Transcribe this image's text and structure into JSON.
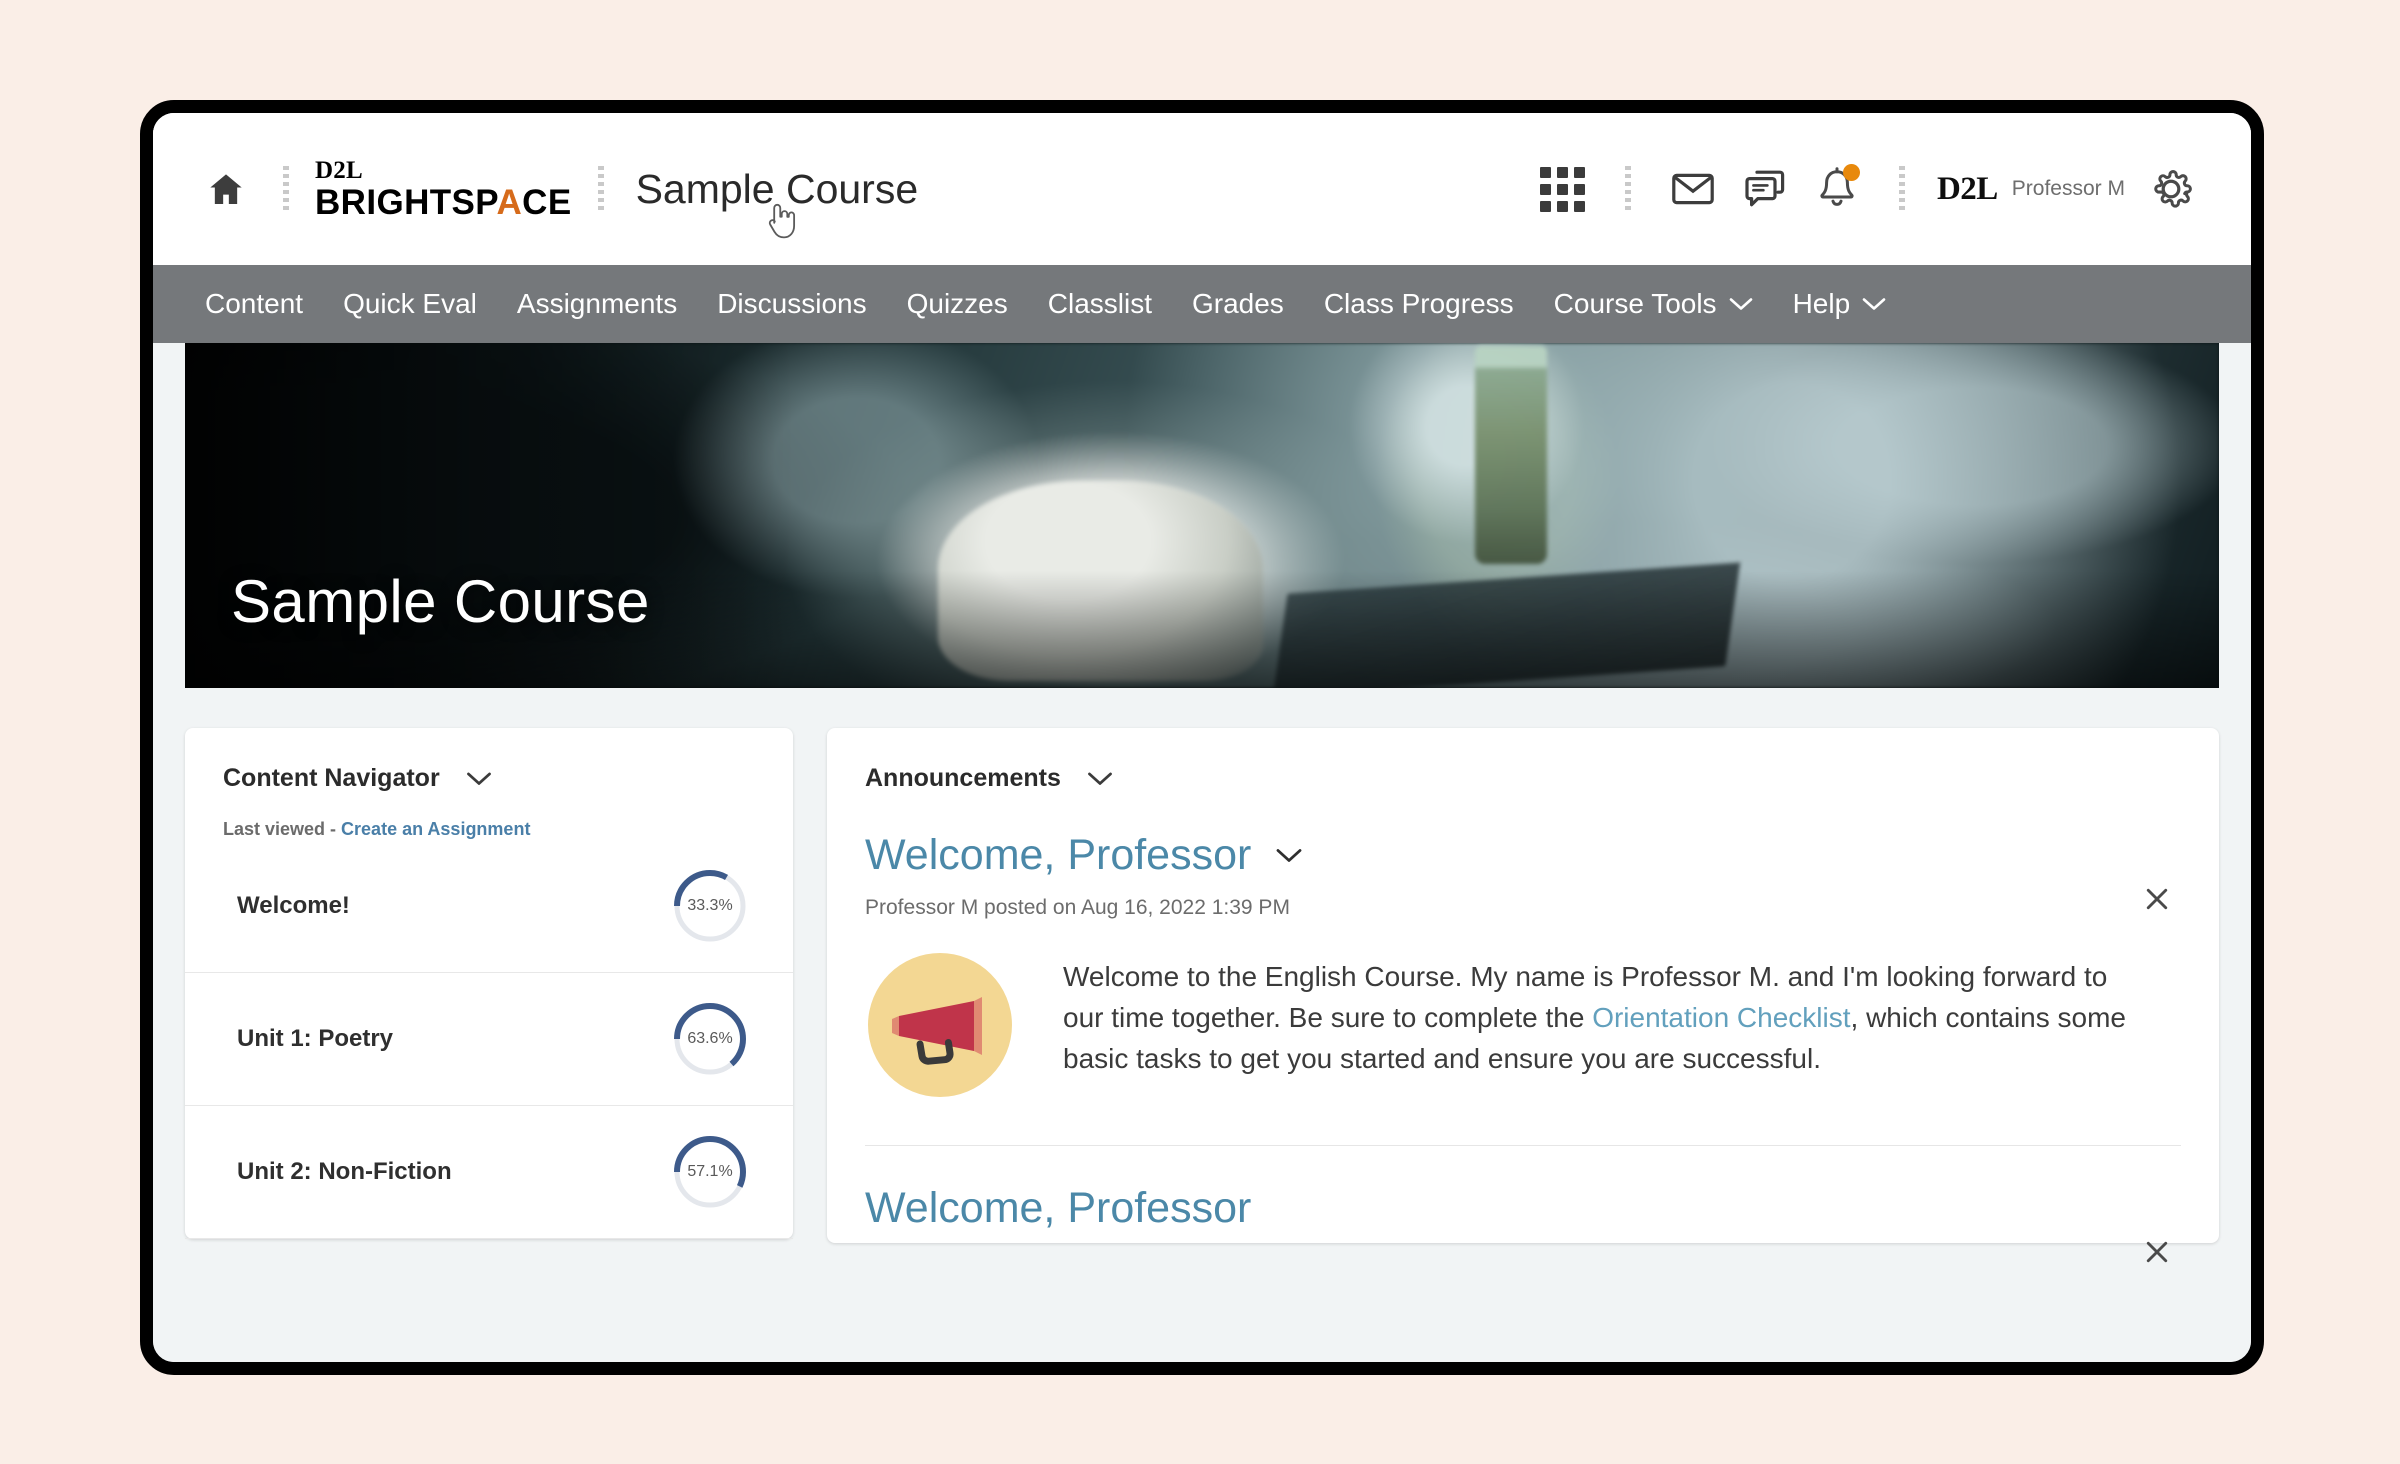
{
  "page": {
    "background_color": "#faeee7",
    "frame_border_color": "#000000"
  },
  "header": {
    "home_icon": "home-icon",
    "brand_line1": "D2L",
    "brand_line2_a": "BRIGHTSP",
    "brand_line2_accent": "A",
    "brand_line2_b": "CE",
    "course_title": "Sample Course",
    "cursor": "pointer-hand-cursor",
    "icons": [
      {
        "name": "waffle-menu-icon",
        "label": "Course Selector"
      },
      {
        "name": "envelope-icon",
        "label": "Email"
      },
      {
        "name": "chat-bubble-icon",
        "label": "Subscriptions"
      },
      {
        "name": "bell-icon",
        "label": "Notifications",
        "badge": true
      }
    ],
    "user": {
      "mark": "D2L",
      "name": "Professor M"
    },
    "settings_icon": "gear-icon",
    "accent_color": "#d66b1b",
    "badge_color": "#e8890c"
  },
  "navbar": {
    "background_color": "#75787b",
    "items": [
      {
        "label": "Content",
        "has_chevron": false
      },
      {
        "label": "Quick Eval",
        "has_chevron": false
      },
      {
        "label": "Assignments",
        "has_chevron": false
      },
      {
        "label": "Discussions",
        "has_chevron": false
      },
      {
        "label": "Quizzes",
        "has_chevron": false
      },
      {
        "label": "Classlist",
        "has_chevron": false
      },
      {
        "label": "Grades",
        "has_chevron": false
      },
      {
        "label": "Class Progress",
        "has_chevron": false
      },
      {
        "label": "Course Tools",
        "has_chevron": true
      },
      {
        "label": "Help",
        "has_chevron": true
      }
    ]
  },
  "hero": {
    "title": "Sample Course",
    "image_description": "hands-typing-on-keyboard-with-coffee-cup"
  },
  "content_navigator": {
    "title": "Content Navigator",
    "chevron_icon": "chevron-down-icon",
    "last_viewed_label": "Last viewed - ",
    "last_viewed_link": "Create an Assignment",
    "items": [
      {
        "label": "Welcome!",
        "percent": "33.3%",
        "value": 33.3
      },
      {
        "label": "Unit 1: Poetry",
        "percent": "63.6%",
        "value": 63.6
      },
      {
        "label": "Unit 2: Non-Fiction",
        "percent": "57.1%",
        "value": 57.1
      }
    ],
    "ring_color": "#3d5a8a",
    "ring_track_color": "#e4e7ec"
  },
  "announcements": {
    "title": "Announcements",
    "chevron_icon": "chevron-down-icon",
    "link_color": "#62a0bd",
    "heading_color": "#4b88a8",
    "items": [
      {
        "title": "Welcome, Professor",
        "chevron_icon": "chevron-down-icon",
        "close_icon": "close-icon",
        "meta": "Professor M posted on Aug 16, 2022 1:39 PM",
        "avatar_icon": "megaphone-icon",
        "avatar_bg": "#f3d793",
        "avatar_fg": "#c0344a",
        "text_part1": "Welcome to the English Course. My name is Professor M. and I'm looking forward to our time together. Be sure to complete the ",
        "text_link": "Orientation Checklist",
        "text_part2": ", which contains some basic tasks to get you started and ensure you are successful."
      },
      {
        "title": "Welcome, Professor",
        "chevron_icon": "chevron-down-icon",
        "close_icon": "close-icon"
      }
    ]
  }
}
